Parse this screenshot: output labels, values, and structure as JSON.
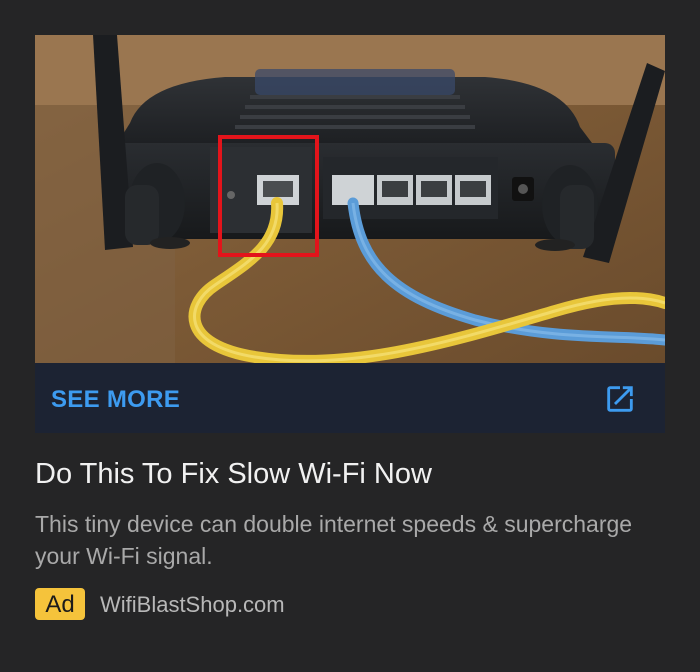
{
  "ad": {
    "media_alt": "Router rear panel with yellow cable in internet port highlighted",
    "cta_label": "SEE MORE",
    "open_icon": "open-in-new-icon",
    "headline": "Do This To Fix Slow Wi-Fi Now",
    "description": "This tiny device can double internet speeds & supercharge your Wi-Fi signal.",
    "badge_label": "Ad",
    "advertiser": "WifiBlastShop.com"
  },
  "colors": {
    "background": "#252526",
    "cta_bar": "#1c2333",
    "accent_blue": "#3d9bf0",
    "badge_yellow": "#f5c33b",
    "highlight_red": "#e3141b",
    "cable_yellow": "#e8c63a",
    "cable_blue": "#5b9cd8"
  }
}
